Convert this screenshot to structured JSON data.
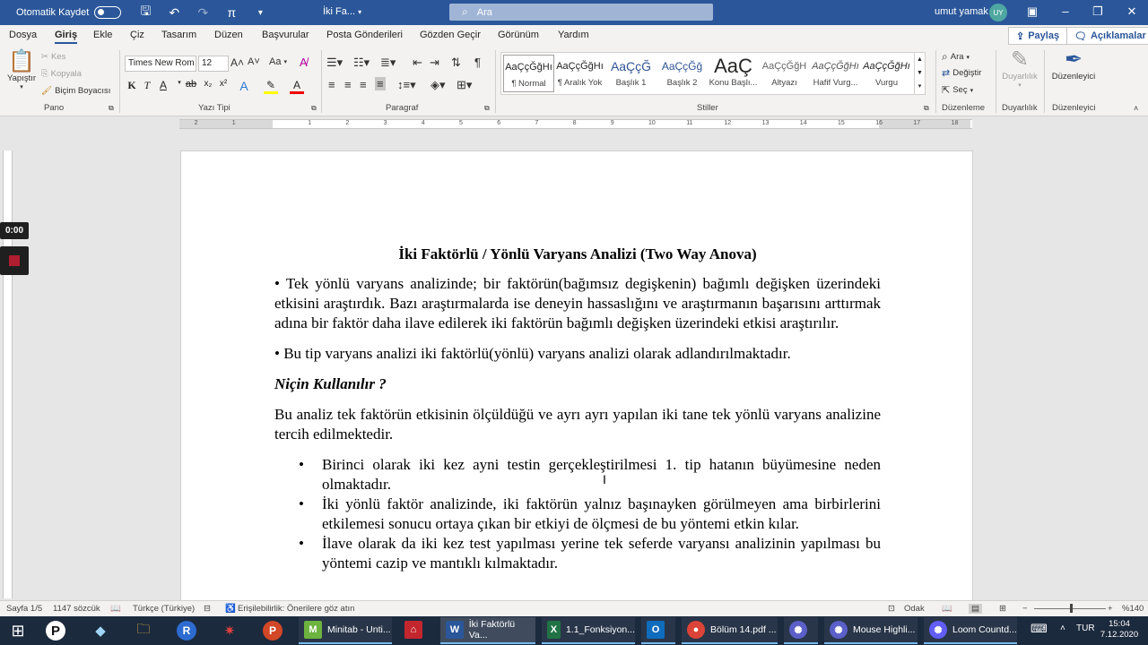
{
  "titlebar": {
    "autosave_label": "Otomatik Kaydet",
    "doc_title": "İki Fa...",
    "search_placeholder": "Ara",
    "user_name": "umut yamak",
    "user_initials": "UY"
  },
  "tabs": [
    "Dosya",
    "Giriş",
    "Ekle",
    "Çiz",
    "Tasarım",
    "Düzen",
    "Başvurular",
    "Posta Gönderileri",
    "Gözden Geçir",
    "Görünüm",
    "Yardım"
  ],
  "active_tab": "Giriş",
  "share_label": "Paylaş",
  "comments_label": "Açıklamalar",
  "ribbon": {
    "clipboard": {
      "paste": "Yapıştır",
      "cut": "Kes",
      "copy": "Kopyala",
      "format_painter": "Biçim Boyacısı",
      "group_label": "Pano"
    },
    "font": {
      "font_name": "Times New Rom",
      "font_size": "12",
      "case_label": "Aa",
      "group_label": "Yazı Tipi"
    },
    "paragraph": {
      "group_label": "Paragraf"
    },
    "styles": {
      "items": [
        {
          "preview": "AaÇçĞğHı",
          "label": "¶ Normal"
        },
        {
          "preview": "AaÇçĞğHı",
          "label": "¶ Aralık Yok"
        },
        {
          "preview": "AaÇçĞ",
          "label": "Başlık 1"
        },
        {
          "preview": "AaÇçĞğ",
          "label": "Başlık 2"
        },
        {
          "preview": "AaÇ",
          "label": "Konu Başlı..."
        },
        {
          "preview": "AaÇçĞğH",
          "label": "Altyazı"
        },
        {
          "preview": "AaÇçĞğHı",
          "label": "Hafif Vurg..."
        },
        {
          "preview": "AaÇçĞğHı",
          "label": "Vurgu"
        }
      ],
      "group_label": "Stiller"
    },
    "editing": {
      "find": "Ara",
      "replace": "Değiştir",
      "select": "Seç",
      "group_label": "Düzenleme"
    },
    "sensitivity": {
      "label": "Duyarlılık",
      "group_label": "Duyarlılık"
    },
    "editor": {
      "label": "Düzenleyici",
      "group_label": "Düzenleyici"
    }
  },
  "ruler_numbers": [
    "2",
    "1",
    "1",
    "2",
    "3",
    "4",
    "5",
    "6",
    "7",
    "8",
    "9",
    "10",
    "11",
    "12",
    "13",
    "14",
    "15",
    "16",
    "17",
    "18"
  ],
  "recording": {
    "time": "0:00"
  },
  "document": {
    "title": "İki Faktörlü / Yönlü Varyans Analizi (Two Way Anova)",
    "p1": "• Tek yönlü varyans analizinde; bir faktörün(bağımsız degişkenin) bağımlı değişken üzerindeki etkisini araştırdık. Bazı araştırmalarda ise deneyin hassaslığını ve araştırmanın başarısını arttırmak adına bir faktör daha ilave edilerek iki faktörün bağımlı değişken üzerindeki etkisi araştırılır.",
    "p2": "• Bu tip varyans analizi iki faktörlü(yönlü) varyans analizi olarak adlandırılmaktadır.",
    "heading": "Niçin Kullanılır ?",
    "p3": "Bu analiz tek faktörün etkisinin ölçüldüğü ve ayrı ayrı yapılan iki tane tek yönlü varyans analizine tercih edilmektedir.",
    "bullets": [
      "Birinci olarak iki kez ayni testin gerçekleştirilmesi 1. tip hatanın büyümesine neden olmaktadır.",
      "İki yönlü faktör analizinde, iki faktörün yalnız başınayken görülmeyen ama birbirlerini etkilemesi sonucu ortaya çıkan bir etkiyi de ölçmesi de bu yöntemi etkin kılar.",
      "İlave olarak da iki kez test yapılması yerine tek seferde varyansı analizinin yapılması bu yöntemi cazip ve mantıklı kılmaktadır."
    ],
    "bullet_char": "•"
  },
  "statusbar": {
    "page": "Sayfa 1/5",
    "words": "1147 sözcük",
    "language": "Türkçe (Türkiye)",
    "accessibility": "Erişilebilirlik: Önerilere göz atın",
    "focus": "Odak",
    "zoom": "%140"
  },
  "taskbar": {
    "apps": [
      {
        "label": "Minitab - Unti...",
        "icon_text": "M",
        "color": "#6cb33f"
      },
      {
        "label": "İki Faktörlü Va...",
        "icon_text": "W",
        "color": "#2b579a"
      },
      {
        "label": "1.1_Fonksiyon...",
        "icon_text": "X",
        "color": "#217346"
      },
      {
        "label": "Bölüm 14.pdf ...",
        "icon_text": "●",
        "color": "#db4437"
      },
      {
        "label": "Mouse Highli...",
        "icon_text": "✺",
        "color": "#5b5fc7"
      },
      {
        "label": "Loom Countd...",
        "icon_text": "✺",
        "color": "#625df5"
      }
    ],
    "language": "TUR",
    "time": "15:04",
    "date": "7.12.2020"
  }
}
